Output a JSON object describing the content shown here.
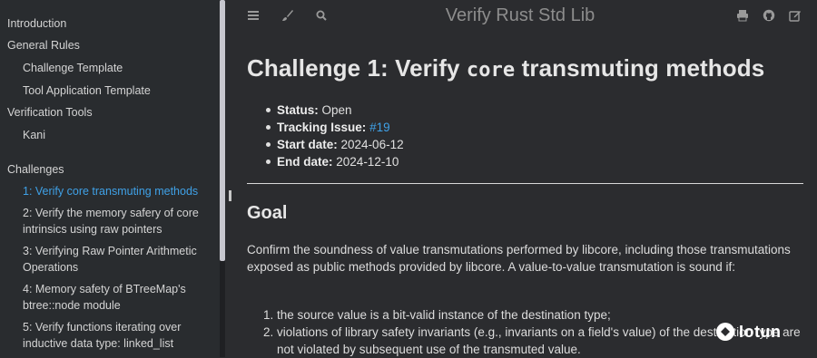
{
  "sidebar": {
    "items": [
      {
        "label": "Introduction"
      },
      {
        "label": "General Rules"
      },
      {
        "label": "Challenge Template"
      },
      {
        "label": "Tool Application Template"
      },
      {
        "label": "Verification Tools"
      },
      {
        "label": "Kani"
      },
      {
        "label": "Challenges"
      },
      {
        "label": "1: Verify core transmuting methods"
      },
      {
        "label": "2: Verify the memory safery of core"
      },
      {
        "label": "intrinsics using raw pointers"
      },
      {
        "label": "3: Verifying Raw Pointer Arithmetic"
      },
      {
        "label": "Operations"
      },
      {
        "label": "4: Memory safety of BTreeMap's"
      },
      {
        "label": "btree::node module"
      },
      {
        "label": "5: Verify functions iterating over"
      },
      {
        "label": "inductive data type: linked_list"
      }
    ],
    "active_color": "#3fa1e7"
  },
  "header": {
    "title": "Verify Rust Std Lib",
    "icons": [
      "menu-icon",
      "paintbrush-icon",
      "search-icon",
      "print-icon",
      "github-icon",
      "edit-icon"
    ]
  },
  "page": {
    "title_prefix": "Challenge 1: Verify ",
    "title_code": "core",
    "title_suffix": " transmuting methods",
    "meta": {
      "status_label": "Status:",
      "status_value": "Open",
      "tracking_label": "Tracking Issue:",
      "tracking_value": "#19",
      "start_label": "Start date:",
      "start_value": "2024-06-12",
      "end_label": "End date:",
      "end_value": "2024-12-10"
    },
    "goal_heading": "Goal",
    "goal_para": "Confirm the soundness of value transmutations performed by libcore, including those transmutations exposed as public methods provided by libcore. A value-to-value transmutation is sound if:",
    "conditions": [
      {
        "num": "1.",
        "text": "the source value is a bit-valid instance of the destination type;"
      },
      {
        "num": "2.",
        "text": "violations of library safety invariants (e.g., invariants on a field's value) of the destination type are not violated by subsequent use of the transmuted value."
      }
    ]
  },
  "watermark": {
    "text": "Iotun"
  }
}
